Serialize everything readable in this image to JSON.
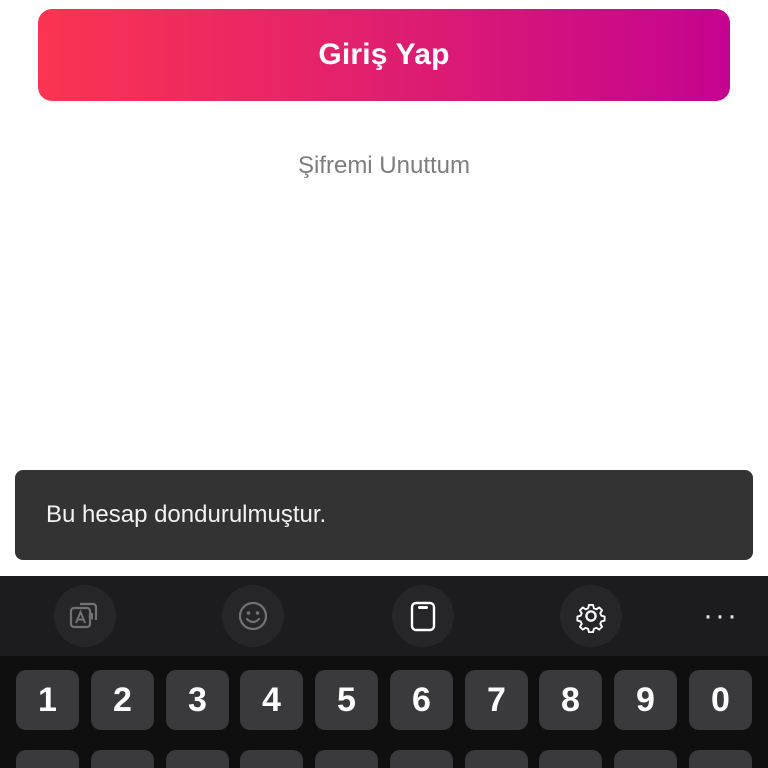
{
  "login": {
    "button_label": "Giriş Yap",
    "gradient_start": "#fb3450",
    "gradient_end": "#c40390"
  },
  "forgot_password": {
    "label": "Şifremi Unuttum"
  },
  "snackbar": {
    "message": "Bu hesap dondurulmuştur."
  },
  "keyboard": {
    "toolbar": {
      "items": [
        {
          "icon": "translate-icon",
          "state": "disabled"
        },
        {
          "icon": "emoji-icon",
          "state": "disabled"
        },
        {
          "icon": "clipboard-icon",
          "state": "enabled"
        },
        {
          "icon": "settings-gear-icon",
          "state": "enabled"
        },
        {
          "icon": "more-icon",
          "state": "enabled"
        }
      ],
      "more_label": "···"
    },
    "number_row": [
      "1",
      "2",
      "3",
      "4",
      "5",
      "6",
      "7",
      "8",
      "9",
      "0"
    ]
  }
}
